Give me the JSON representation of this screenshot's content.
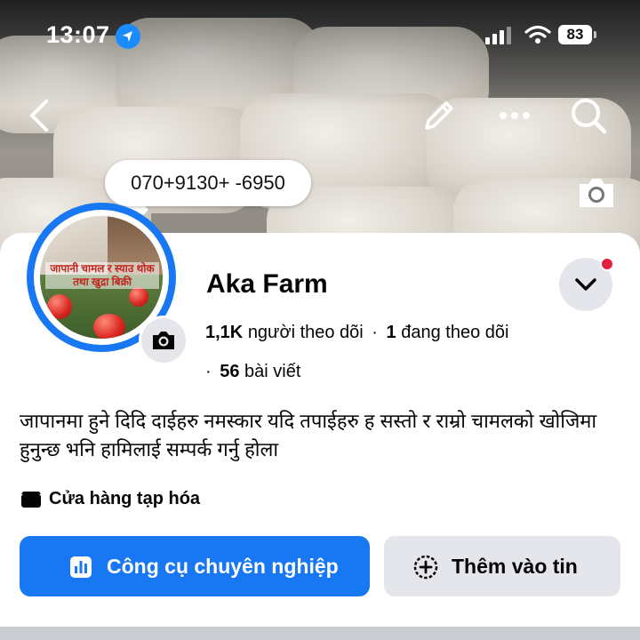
{
  "status_bar": {
    "time": "13:07",
    "battery": "83",
    "icons": [
      "location-arrow-icon",
      "cell-signal-icon",
      "wifi-icon",
      "battery-icon"
    ]
  },
  "top_bar": {
    "icons": [
      "back-chevron-icon",
      "pencil-icon",
      "more-icon",
      "search-icon"
    ]
  },
  "cover": {
    "icon": "camera-icon"
  },
  "phone_bubble": "070+9130+ -6950",
  "profile": {
    "name": "Aka Farm",
    "avatar_text": "जापानी चामल र स्याउ थोक तथा खुद्रा बिक्री",
    "followers_count": "1,1K",
    "followers_label": "người theo dõi",
    "separator": "·",
    "following_count": "1",
    "following_label": "đang theo dõi",
    "posts_count": "56",
    "posts_label": "bài viết",
    "dropdown_icon": "chevron-down-icon"
  },
  "bio": "जापानमा हुने दिदि दाईहरु नमस्कार यदि तपाईहरु ह सस्तो र राम्रो चामलको खोजिमा हुनुन्छ भनि हामिलाई सम्पर्क गर्नु होला",
  "category": {
    "icon": "clapperboard-icon",
    "label": "Cửa hàng tạp hóa"
  },
  "buttons": {
    "primary_label": "Công cụ chuyên nghiệp",
    "primary_icon": "bar-chart-icon",
    "secondary_label": "Thêm vào tin",
    "secondary_icon": "plus-circle-icon"
  },
  "colors": {
    "accent": "#1877f2",
    "secondary_button": "#e4e6eb",
    "notification_dot": "#e41e3f"
  }
}
